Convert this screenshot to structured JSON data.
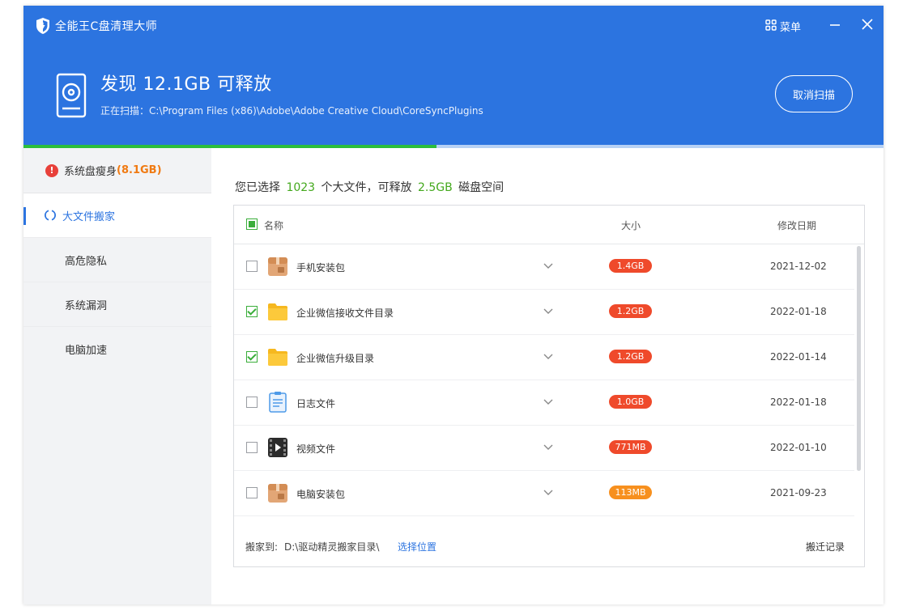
{
  "app": {
    "title": "全能王C盘清理大师",
    "menu_label": "菜单"
  },
  "scan": {
    "title": "发现 12.1GB 可释放",
    "path_label": "正在扫描：",
    "path": "C:\\Program Files (x86)\\Adobe\\Adobe Creative Cloud\\CoreSyncPlugins",
    "cancel_label": "取消扫描",
    "progress": 0.48
  },
  "sidebar": {
    "items": [
      {
        "label": "系统盘瘦身",
        "value": "(8.1GB)"
      },
      {
        "label": "大文件搬家"
      },
      {
        "label": "高危隐私"
      },
      {
        "label": "系统漏洞"
      },
      {
        "label": "电脑加速"
      }
    ]
  },
  "summary": {
    "pre": "您已选择",
    "count": "1023",
    "mid": "个大文件，可释放",
    "size": "2.5GB",
    "post": "磁盘空间"
  },
  "table": {
    "headers": {
      "name": "名称",
      "size": "大小",
      "date": "修改日期"
    },
    "rows": [
      {
        "name": "手机安装包",
        "size": "1.4GB",
        "date": "2021-12-02",
        "checked": false,
        "icon": "package-icon"
      },
      {
        "name": "企业微信接收文件目录",
        "size": "1.2GB",
        "date": "2022-01-18",
        "checked": true,
        "icon": "folder-icon"
      },
      {
        "name": "企业微信升级目录",
        "size": "1.2GB",
        "date": "2022-01-14",
        "checked": true,
        "icon": "folder-icon"
      },
      {
        "name": "日志文件",
        "size": "1.0GB",
        "date": "2022-01-18",
        "checked": false,
        "icon": "log-file-icon"
      },
      {
        "name": "视频文件",
        "size": "771MB",
        "date": "2022-01-10",
        "checked": false,
        "icon": "video-file-icon"
      },
      {
        "name": "电脑安装包",
        "size": "113MB",
        "date": "2021-09-23",
        "checked": false,
        "icon": "package-icon"
      }
    ]
  },
  "footer": {
    "move_label": "搬家到:",
    "move_path": "D:\\驱动精灵搬家目录\\",
    "pick_label": "选择位置",
    "history_label": "搬迁记录"
  },
  "colors": {
    "primary": "#2c74e0",
    "badge_red": "#ef4a2b",
    "badge_orange": "#f7901e",
    "green": "#43a81c",
    "progress": "#2cbe3c"
  }
}
